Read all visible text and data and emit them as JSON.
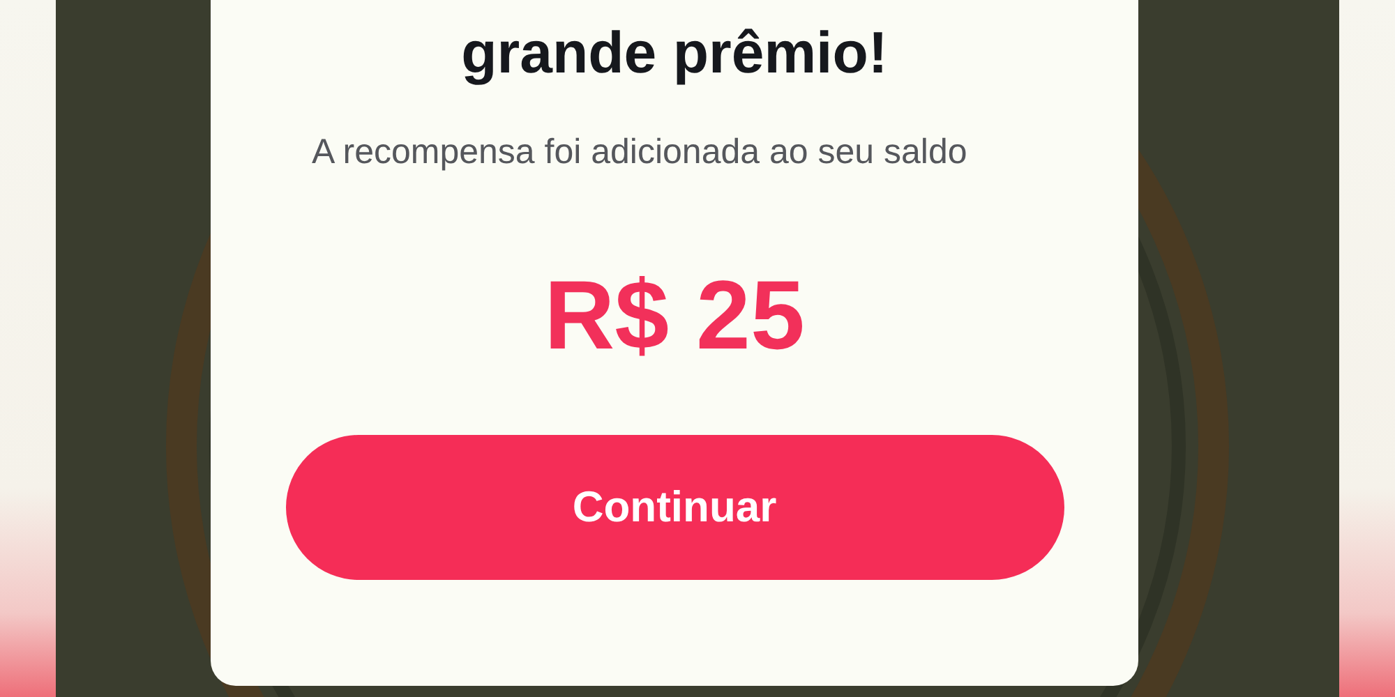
{
  "dialog": {
    "title": "grande prêmio!",
    "message": "A recompensa foi adicionada ao seu saldo",
    "amount": "R$ 25",
    "button": "Continuar"
  }
}
